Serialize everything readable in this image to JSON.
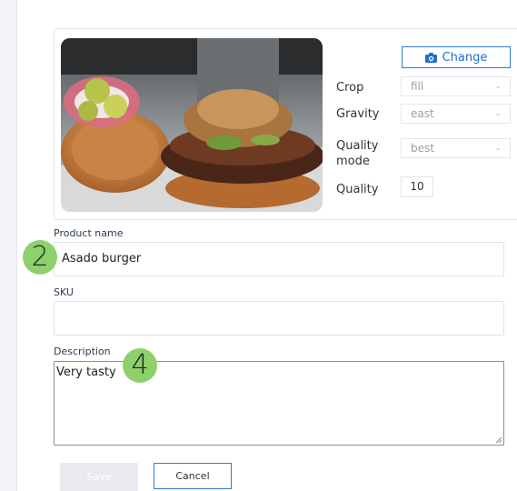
{
  "image": {
    "change_label": "Change",
    "options": {
      "crop": {
        "label": "Crop",
        "value": "fill"
      },
      "gravity": {
        "label": "Gravity",
        "value": "east"
      },
      "quality_mode": {
        "label_line1": "Quality",
        "label_line2": "mode",
        "value": "best"
      },
      "quality": {
        "label": "Quality",
        "value": "10"
      }
    },
    "photo_icon": "burger-photo"
  },
  "form": {
    "product_name": {
      "label": "Product name",
      "value": "Asado burger"
    },
    "sku": {
      "label": "SKU",
      "value": ""
    },
    "description": {
      "label": "Description",
      "value": "Very tasty"
    }
  },
  "badges": {
    "step_2": "2",
    "step_4": "4"
  },
  "actions": {
    "save_label": "Save",
    "cancel_label": "Cancel"
  },
  "colors": {
    "accent": "#2f7bd6",
    "badge": "#8ed06b",
    "sidebar": "#f3f5fb"
  }
}
